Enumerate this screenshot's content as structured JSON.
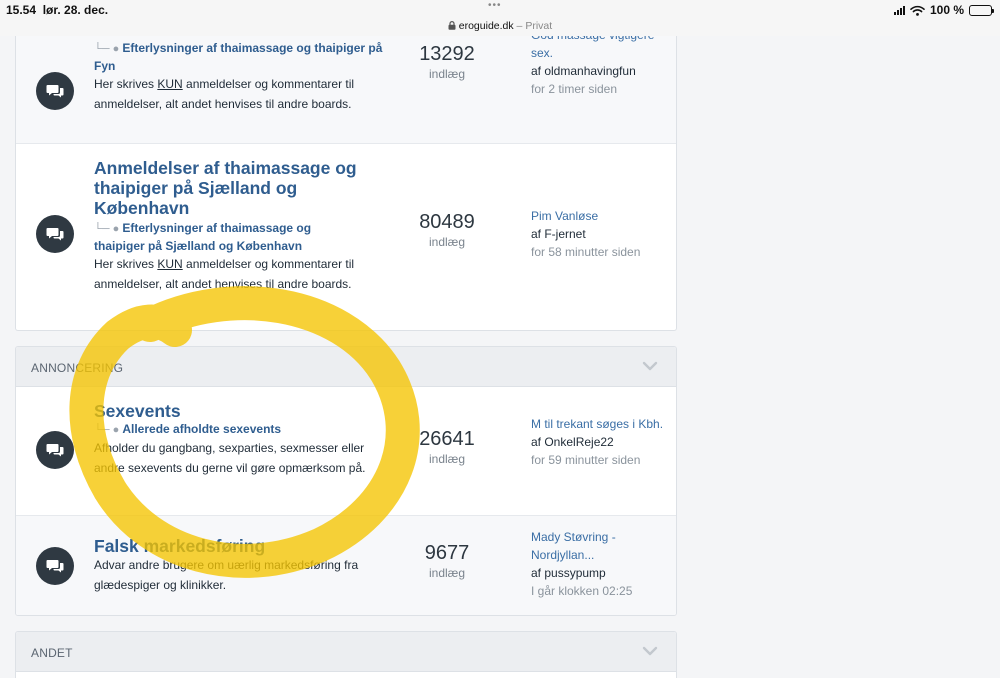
{
  "statusbar": {
    "time": "15.54",
    "date": "lør. 28. dec.",
    "dots": "•••",
    "url": "eroguide.dk",
    "private_sep": " – ",
    "private": "Privat",
    "battery": "100 %"
  },
  "forums_top": [
    {
      "title": "",
      "sub_prefix": "└─ ● ",
      "sub_label": "Efterlysninger af thaimassage og thaipiger på Fyn",
      "desc_before": "Her skrives ",
      "desc_underlined": "KUN",
      "desc_after": " anmeldelser og kommentarer til anmeldelser, alt andet henvises til andre boards.",
      "count": "13292",
      "count_label": "indlæg",
      "last_title": "God massage vigtigere sex.",
      "last_by": "af oldmanhavingfun",
      "last_time": "for 2 timer siden"
    },
    {
      "title": "Anmeldelser af thaimassage og thaipiger på Sjælland og København",
      "sub_prefix": "└─ ● ",
      "sub_label": "Efterlysninger af thaimassage og thaipiger på Sjælland og København",
      "desc_before": "Her skrives ",
      "desc_underlined": "KUN",
      "desc_after": " anmeldelser og kommentarer til anmeldelser, alt andet henvises til andre boards.",
      "count": "80489",
      "count_label": "indlæg",
      "last_title": "Pim Vanløse",
      "last_by": "af F-jernet",
      "last_time": "for 58 minutter siden"
    }
  ],
  "sections": {
    "announcing": {
      "heading": "ANNONCERING",
      "forums": [
        {
          "title": "Sexevents",
          "sub_prefix": "└─ ● ",
          "sub_label": "Allerede afholdte sexevents",
          "desc": "Afholder du gangbang, sexparties, sexmesser eller andre sexevents du gerne vil gøre opmærksom på.",
          "count": "26641",
          "count_label": "indlæg",
          "last_title": "M til trekant søges i Kbh.",
          "last_by": "af OnkelReje22",
          "last_time": "for 59 minutter siden"
        },
        {
          "title": "Falsk markedsføring",
          "desc": "Advar andre brugere om uærlig markedsføring fra glædespiger og klinikker.",
          "count": "9677",
          "count_label": "indlæg",
          "last_title": "Mady Støvring - Nordjyllan...",
          "last_by": "af pussypump",
          "last_time": "I går klokken 02:25"
        }
      ]
    },
    "other": {
      "heading": "ANDET"
    }
  },
  "colors": {
    "link": "#2f5d8f",
    "highlight": "#f5c400",
    "icon_bg": "#2f3942"
  },
  "icons": {
    "forum": "chat-bubbles-icon",
    "collapse": "chevron-down-icon",
    "lock": "lock-icon",
    "wifi": "wifi-icon",
    "signal": "signal-icon",
    "battery": "battery-icon"
  }
}
